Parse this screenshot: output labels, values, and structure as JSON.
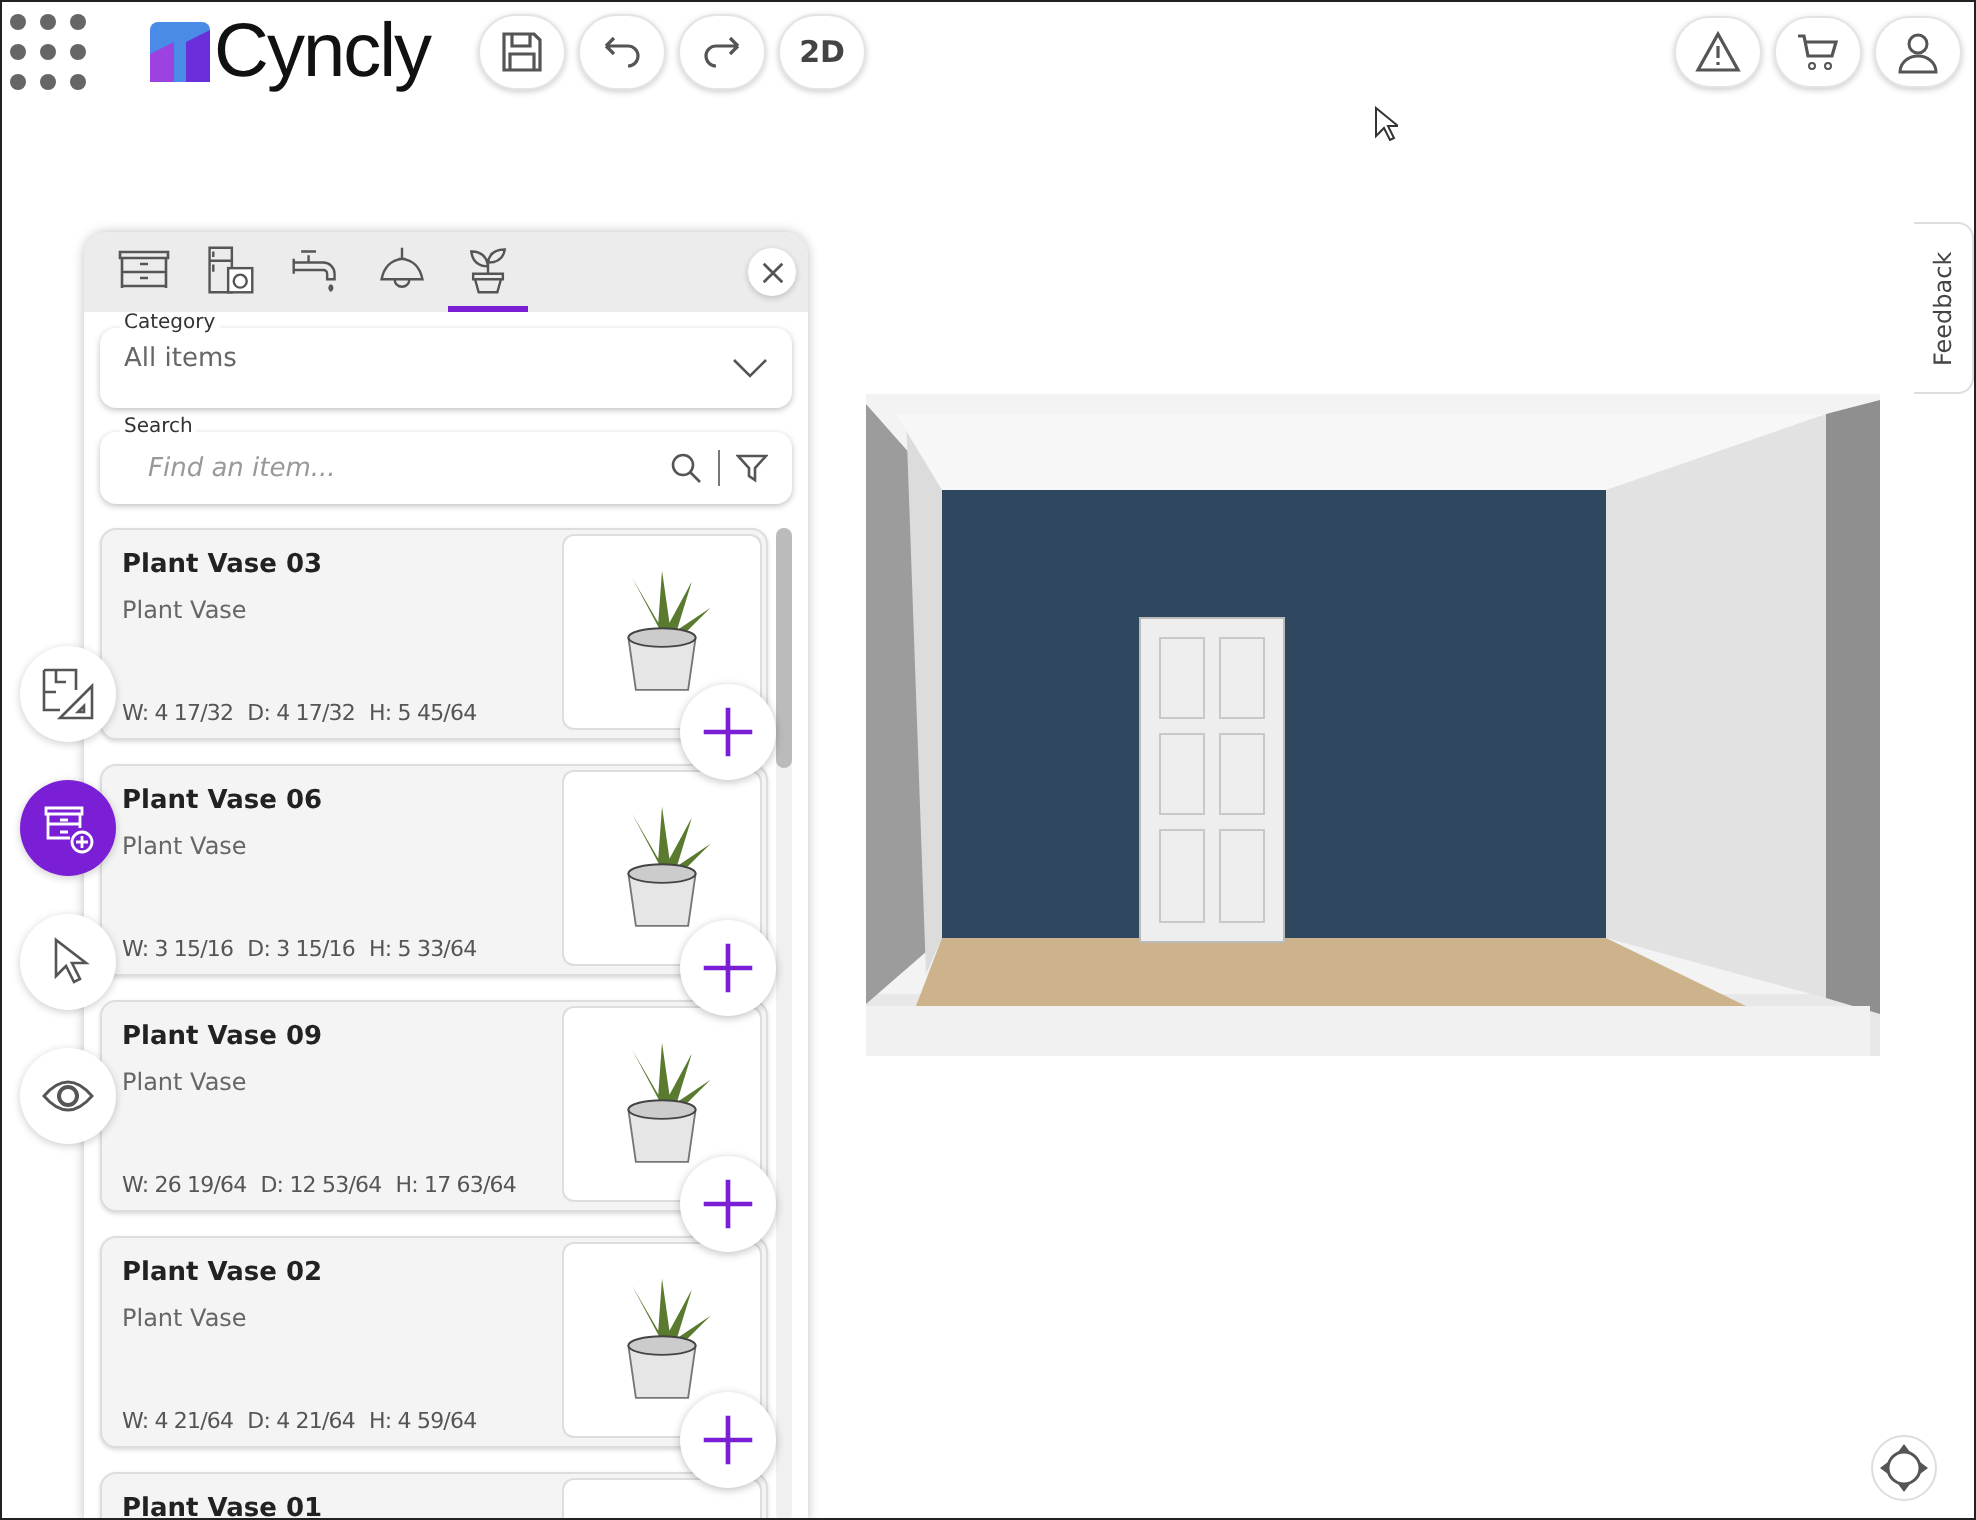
{
  "header": {
    "logo": "Cyncly",
    "tools": [
      {
        "kind": "save"
      },
      {
        "kind": "undo"
      },
      {
        "kind": "redo"
      },
      {
        "kind": "text",
        "label": "2D"
      }
    ],
    "actions": [
      {
        "kind": "warning"
      },
      {
        "kind": "cart"
      },
      {
        "kind": "user"
      }
    ]
  },
  "panel": {
    "tabs": [
      {
        "kind": "cabinet",
        "selected": false
      },
      {
        "kind": "appliance",
        "selected": false
      },
      {
        "kind": "faucet",
        "selected": false
      },
      {
        "kind": "lamp",
        "selected": false
      },
      {
        "kind": "plant",
        "selected": true
      }
    ],
    "category": {
      "label": "Category",
      "value": "All items"
    },
    "search": {
      "label": "Search",
      "placeholder": "Find an item..."
    },
    "items": [
      {
        "name": "Plant Vase 03",
        "type": "Plant Vase",
        "dims": [
          "W: 4 17/32",
          "D: 4 17/32",
          "H: 5 45/64"
        ]
      },
      {
        "name": "Plant Vase 06",
        "type": "Plant Vase",
        "dims": [
          "W: 3 15/16",
          "D: 3 15/16",
          "H: 5 33/64"
        ]
      },
      {
        "name": "Plant Vase 09",
        "type": "Plant Vase",
        "dims": [
          "W: 26 19/64",
          "D: 12 53/64",
          "H: 17 63/64"
        ]
      },
      {
        "name": "Plant Vase 02",
        "type": "Plant Vase",
        "dims": [
          "W: 4 21/64",
          "D: 4 21/64",
          "H: 4 59/64"
        ]
      },
      {
        "name": "Plant Vase 01"
      }
    ]
  },
  "rail": [
    {
      "kind": "plan",
      "selected": false
    },
    {
      "kind": "add",
      "selected": true
    },
    {
      "kind": "pointer",
      "selected": false
    },
    {
      "kind": "view",
      "selected": false
    }
  ],
  "feedback": "Feedback"
}
